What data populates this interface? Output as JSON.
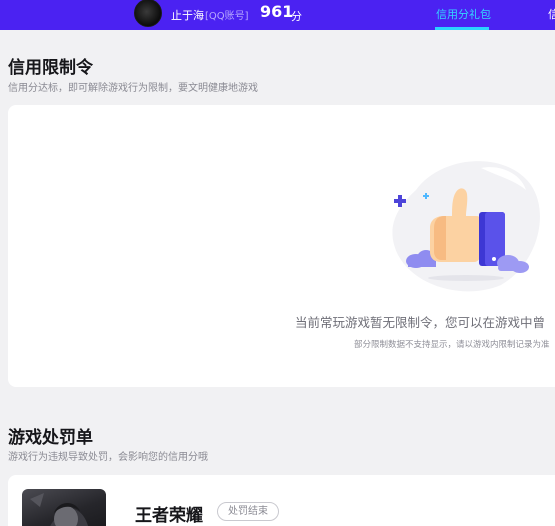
{
  "header": {
    "username": "止于海",
    "account_type": "[QQ账号]",
    "score": "961",
    "score_unit": "分",
    "tabs": [
      {
        "label": "信用分礼包",
        "active": true
      },
      {
        "label": "信",
        "active": false
      }
    ],
    "colors": {
      "bar": "#4b22f2",
      "active_tab": "#34d6ff"
    }
  },
  "restriction": {
    "title": "信用限制令",
    "description": "信用分达标，即可解除游戏行为限制，要文明健康地游戏",
    "empty_text": "当前常玩游戏暂无限制令，您可以在游戏中曾",
    "empty_note": "部分限制数据不支持显示，请以游戏内限制记录为准",
    "illustration_icon": "thumbs-up-icon"
  },
  "penalty": {
    "title": "游戏处罚单",
    "description": "游戏行为违规导致处罚，会影响您的信用分哦",
    "items": [
      {
        "game": "王者荣耀",
        "status": "处罚结束"
      }
    ]
  }
}
